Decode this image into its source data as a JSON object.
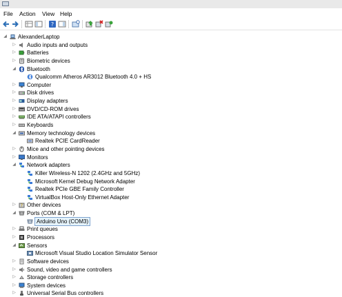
{
  "menu": [
    "File",
    "Action",
    "View",
    "Help"
  ],
  "tree": {
    "root": "AlexanderLaptop",
    "categories": [
      {
        "label": "Audio inputs and outputs",
        "icon": "speaker-icon",
        "expanded": false
      },
      {
        "label": "Batteries",
        "icon": "battery-icon",
        "expanded": false
      },
      {
        "label": "Biometric devices",
        "icon": "fingerprint-icon",
        "expanded": false
      },
      {
        "label": "Bluetooth",
        "icon": "bluetooth-icon",
        "expanded": true,
        "children": [
          "Qualcomm Atheros AR3012 Bluetooth 4.0 + HS"
        ]
      },
      {
        "label": "Computer",
        "icon": "computer-icon",
        "expanded": false
      },
      {
        "label": "Disk drives",
        "icon": "disk-drive-icon",
        "expanded": false
      },
      {
        "label": "Display adapters",
        "icon": "display-adapter-icon",
        "expanded": false
      },
      {
        "label": "DVD/CD-ROM drives",
        "icon": "optical-drive-icon",
        "expanded": false
      },
      {
        "label": "IDE ATA/ATAPI controllers",
        "icon": "ide-controller-icon",
        "expanded": false
      },
      {
        "label": "Keyboards",
        "icon": "keyboard-icon",
        "expanded": false
      },
      {
        "label": "Memory technology devices",
        "icon": "memory-icon",
        "expanded": true,
        "children": [
          "Realtek PCIE CardReader"
        ]
      },
      {
        "label": "Mice and other pointing devices",
        "icon": "mouse-icon",
        "expanded": false
      },
      {
        "label": "Monitors",
        "icon": "monitor-icon",
        "expanded": false
      },
      {
        "label": "Network adapters",
        "icon": "network-icon",
        "expanded": true,
        "children": [
          "Killer Wireless-N 1202 (2.4GHz and 5GHz)",
          "Microsoft Kernel Debug Network Adapter",
          "Realtek PCIe GBE Family Controller",
          "VirtualBox Host-Only Ethernet Adapter"
        ]
      },
      {
        "label": "Other devices",
        "icon": "other-devices-icon",
        "expanded": false
      },
      {
        "label": "Ports (COM & LPT)",
        "icon": "port-icon",
        "expanded": true,
        "children": [
          "Arduino Uno (COM3)"
        ]
      },
      {
        "label": "Print queues",
        "icon": "printer-icon",
        "expanded": false
      },
      {
        "label": "Processors",
        "icon": "processor-icon",
        "expanded": false
      },
      {
        "label": "Sensors",
        "icon": "sensor-icon",
        "expanded": true,
        "children": [
          "Microsoft Visual Studio Location Simulator Sensor"
        ]
      },
      {
        "label": "Software devices",
        "icon": "software-device-icon",
        "expanded": false
      },
      {
        "label": "Sound, video and game controllers",
        "icon": "sound-icon",
        "expanded": false
      },
      {
        "label": "Storage controllers",
        "icon": "storage-icon",
        "expanded": false
      },
      {
        "label": "System devices",
        "icon": "system-devices-icon",
        "expanded": false
      },
      {
        "label": "Universal Serial Bus controllers",
        "icon": "usb-icon",
        "expanded": false
      }
    ]
  },
  "selected": "Arduino Uno (COM3)"
}
